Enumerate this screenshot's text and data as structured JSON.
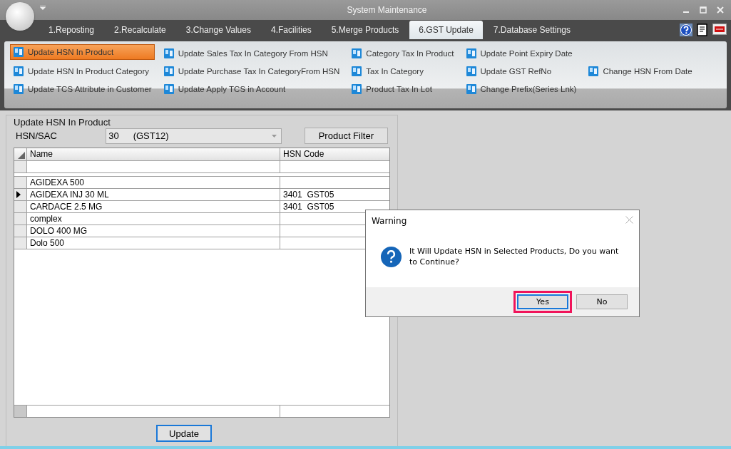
{
  "window": {
    "title": "System Maintenance"
  },
  "tabs": [
    {
      "label": "1.Reposting",
      "selected": false
    },
    {
      "label": "2.Recalculate",
      "selected": false
    },
    {
      "label": "3.Change Values",
      "selected": false
    },
    {
      "label": "4.Facilities",
      "selected": false
    },
    {
      "label": "5.Merge Products",
      "selected": false
    },
    {
      "label": "6.GST Update",
      "selected": true
    },
    {
      "label": "7.Database Settings",
      "selected": false
    }
  ],
  "ribbon": {
    "columns": [
      {
        "items": [
          {
            "label": "Update HSN In Product",
            "selected": true
          },
          {
            "label": "Update HSN In Product Category",
            "selected": false
          },
          {
            "label": "Update TCS Attribute in Customer",
            "selected": false
          }
        ]
      },
      {
        "items": [
          {
            "label": "Update Sales Tax In Category From HSN",
            "selected": false
          },
          {
            "label": "Update Purchase Tax In CategoryFrom HSN",
            "selected": false
          },
          {
            "label": "Update Apply TCS in Account",
            "selected": false
          }
        ]
      },
      {
        "items": [
          {
            "label": "Category Tax In Product",
            "selected": false
          },
          {
            "label": "Tax In Category",
            "selected": false
          },
          {
            "label": "Product Tax In Lot",
            "selected": false
          }
        ]
      },
      {
        "items": [
          {
            "label": "Update Point Expiry Date",
            "selected": false
          },
          {
            "label": "Update GST RefNo",
            "selected": false
          },
          {
            "label": "Change Prefix(Series Lnk)",
            "selected": false
          }
        ]
      },
      {
        "items": [
          {
            "label": "Change HSN From Date",
            "selected": false
          }
        ]
      }
    ]
  },
  "panel": {
    "title": "Update HSN In Product",
    "hsn_label": "HSN/SAC",
    "hsn_value": "30",
    "hsn_tax_group": "(GST12)",
    "filter_button": "Product Filter",
    "table": {
      "columns": [
        "Name",
        "HSN Code"
      ],
      "rows": [
        {
          "name": "AGIDEXA 500",
          "selected": false
        },
        {
          "name": "AGIDEXA INJ 30 ML",
          "hsn_code": "3401",
          "tax_group": "GST05",
          "selected": true
        },
        {
          "name": "CARDACE 2.5 MG",
          "hsn_code": "3401",
          "tax_group": "GST05",
          "selected": false
        },
        {
          "name": "complex",
          "selected": false
        },
        {
          "name": "DOLO 400 MG",
          "selected": false
        },
        {
          "name": "Dolo 500",
          "selected": false
        }
      ]
    },
    "update_button": "Update"
  },
  "dialog": {
    "title": "Warning",
    "message": "It Will Update HSN in Selected Products, Do you want to Continue?",
    "buttons": [
      {
        "label": "Yes",
        "focused": true,
        "highlighted": true
      },
      {
        "label": "No",
        "focused": false,
        "highlighted": false
      }
    ]
  }
}
